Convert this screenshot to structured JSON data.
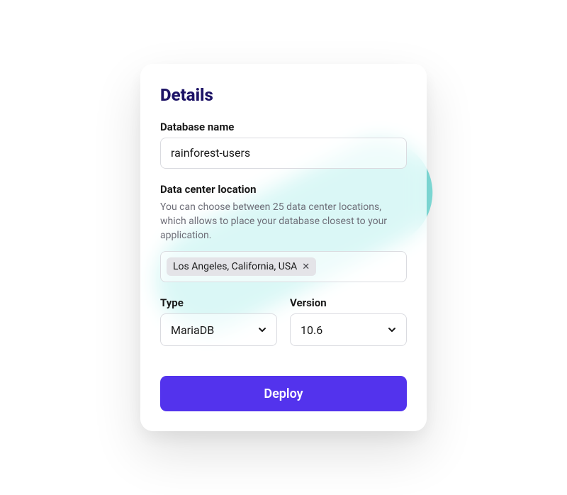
{
  "card": {
    "title": "Details"
  },
  "database_name": {
    "label": "Database name",
    "value": "rainforest-users"
  },
  "location": {
    "label": "Data center location",
    "help": "You can choose between 25 data center locations, which allows to place your database closest to your application.",
    "selected": "Los Angeles, California, USA"
  },
  "type": {
    "label": "Type",
    "value": "MariaDB"
  },
  "version": {
    "label": "Version",
    "value": "10.6"
  },
  "actions": {
    "deploy_label": "Deploy"
  }
}
